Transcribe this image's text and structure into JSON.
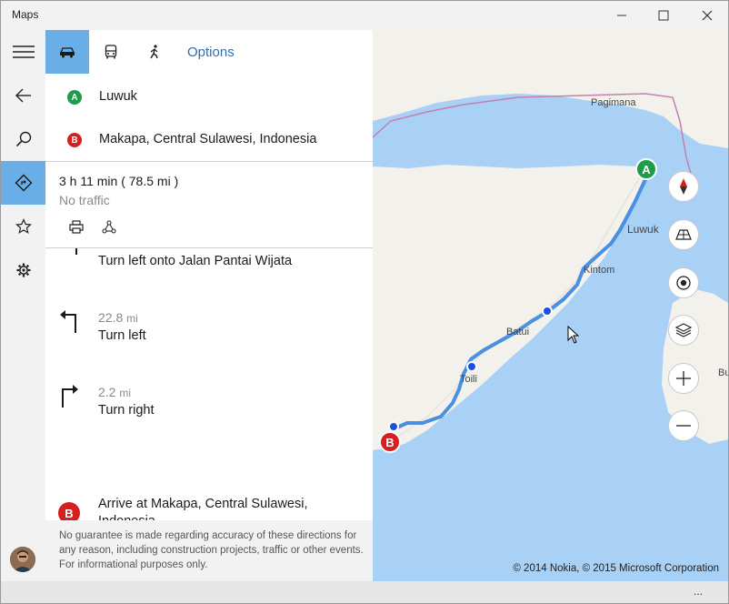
{
  "window": {
    "title": "Maps"
  },
  "colors": {
    "accent": "#6aaee8",
    "link": "#2b6fb6",
    "start_marker": "#1e9c4a",
    "end_marker": "#d6201f",
    "route": "#4a90e2",
    "water": "#a9d0f5",
    "land": "#f3f1ec",
    "via_point": "#1f4fe0"
  },
  "rail": {
    "items": [
      {
        "icon": "hamburger-menu-icon"
      },
      {
        "icon": "back-arrow-icon"
      },
      {
        "icon": "search-icon"
      },
      {
        "icon": "directions-icon",
        "active": true
      },
      {
        "icon": "star-icon"
      },
      {
        "icon": "gear-icon"
      }
    ]
  },
  "modes": {
    "options_label": "Options",
    "items": [
      {
        "icon": "car-icon",
        "active": true
      },
      {
        "icon": "bus-icon"
      },
      {
        "icon": "walking-icon"
      }
    ]
  },
  "route": {
    "origin": {
      "marker": "A",
      "label": "Luwuk"
    },
    "destination": {
      "marker": "B",
      "label": "Makapa, Central Sulawesi, Indonesia"
    },
    "duration": "3 h 11 min ( 78.5 mi )",
    "traffic": "No traffic"
  },
  "steps": [
    {
      "icon": "turn-left-icon",
      "distance": "",
      "unit": "",
      "instruction": "Turn left onto Jalan Pantai Wijata"
    },
    {
      "icon": "turn-left-icon",
      "distance": "22.8",
      "unit": "mi",
      "instruction": "Turn left"
    },
    {
      "icon": "turn-right-icon",
      "distance": "2.2",
      "unit": "mi",
      "instruction": "Turn right"
    }
  ],
  "arrive": {
    "marker": "B",
    "text": "Arrive at Makapa, Central Sulawesi, Indonesia"
  },
  "disclaimer": "No guarantee is made regarding accuracy of these directions for any reason, including construction projects, traffic or other events. For informational purposes only.",
  "map": {
    "labels": {
      "pagimana": "Pagimana",
      "luwuk": "Luwuk",
      "kintom": "Kintom",
      "batui": "Batui",
      "toili": "Toili",
      "bu": "Bu"
    },
    "marker_start": "A",
    "marker_end": "B",
    "controls": [
      "compass-icon",
      "tilt-3d-icon",
      "locate-me-icon",
      "layers-icon",
      "zoom-in-icon",
      "zoom-out-icon"
    ],
    "copyright": "© 2014 Nokia, © 2015 Microsoft Corporation"
  },
  "bottom": {
    "more": "..."
  }
}
